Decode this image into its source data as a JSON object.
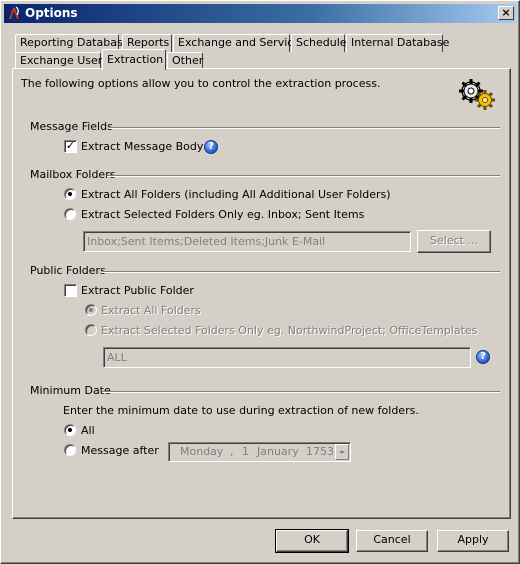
{
  "window": {
    "title": "Options",
    "close_glyph": "×",
    "app_icon": "app-logo-icon"
  },
  "tabs_row1": [
    {
      "label": "Reporting Database"
    },
    {
      "label": "Reports"
    },
    {
      "label": "Exchange and Service"
    },
    {
      "label": "Schedule"
    },
    {
      "label": "Internal Database"
    }
  ],
  "tabs_row2": [
    {
      "label": "Exchange Users"
    },
    {
      "label": "Extraction",
      "active": true
    },
    {
      "label": "Other"
    }
  ],
  "panel": {
    "intro": "The following options allow you to control the extraction process.",
    "header_icon": "gears-icon"
  },
  "message_fields": {
    "heading": "Message Fields",
    "extract_body": {
      "label": "Extract Message Body",
      "checked": true,
      "glyph": "✓"
    },
    "help_glyph": "?"
  },
  "mailbox_folders": {
    "heading": "Mailbox Folders",
    "all_folders": {
      "label": "Extract All Folders (including All Additional User Folders)",
      "checked": true
    },
    "selected_folders": {
      "label": "Extract Selected Folders Only  eg. Inbox; Sent Items",
      "checked": false
    },
    "folders_value": "Inbox;Sent Items;Deleted Items;Junk E-Mail",
    "select_button": "Select ..."
  },
  "public_folders": {
    "heading": "Public Folders",
    "extract_public": {
      "label": "Extract Public Folder",
      "checked": false
    },
    "all_folders": {
      "label": "Extract All Folders",
      "checked": true,
      "disabled": true
    },
    "selected_folders": {
      "label": "Extract Selected Folders Only eg. NorthwindProject; OfficeTemplates",
      "checked": false,
      "disabled": true
    },
    "folders_value": "ALL",
    "help_glyph": "?"
  },
  "minimum_date": {
    "heading": "Minimum Date",
    "instruction": "Enter the minimum date to use during extraction of new folders.",
    "all": {
      "label": "All",
      "checked": true
    },
    "message_after": {
      "label": "Message after",
      "checked": false
    },
    "date": {
      "weekday": "Monday",
      "sep": ",",
      "day": "1",
      "month": "January",
      "year": "1753"
    }
  },
  "buttons": {
    "ok": "OK",
    "cancel": "Cancel",
    "apply": "Apply"
  }
}
